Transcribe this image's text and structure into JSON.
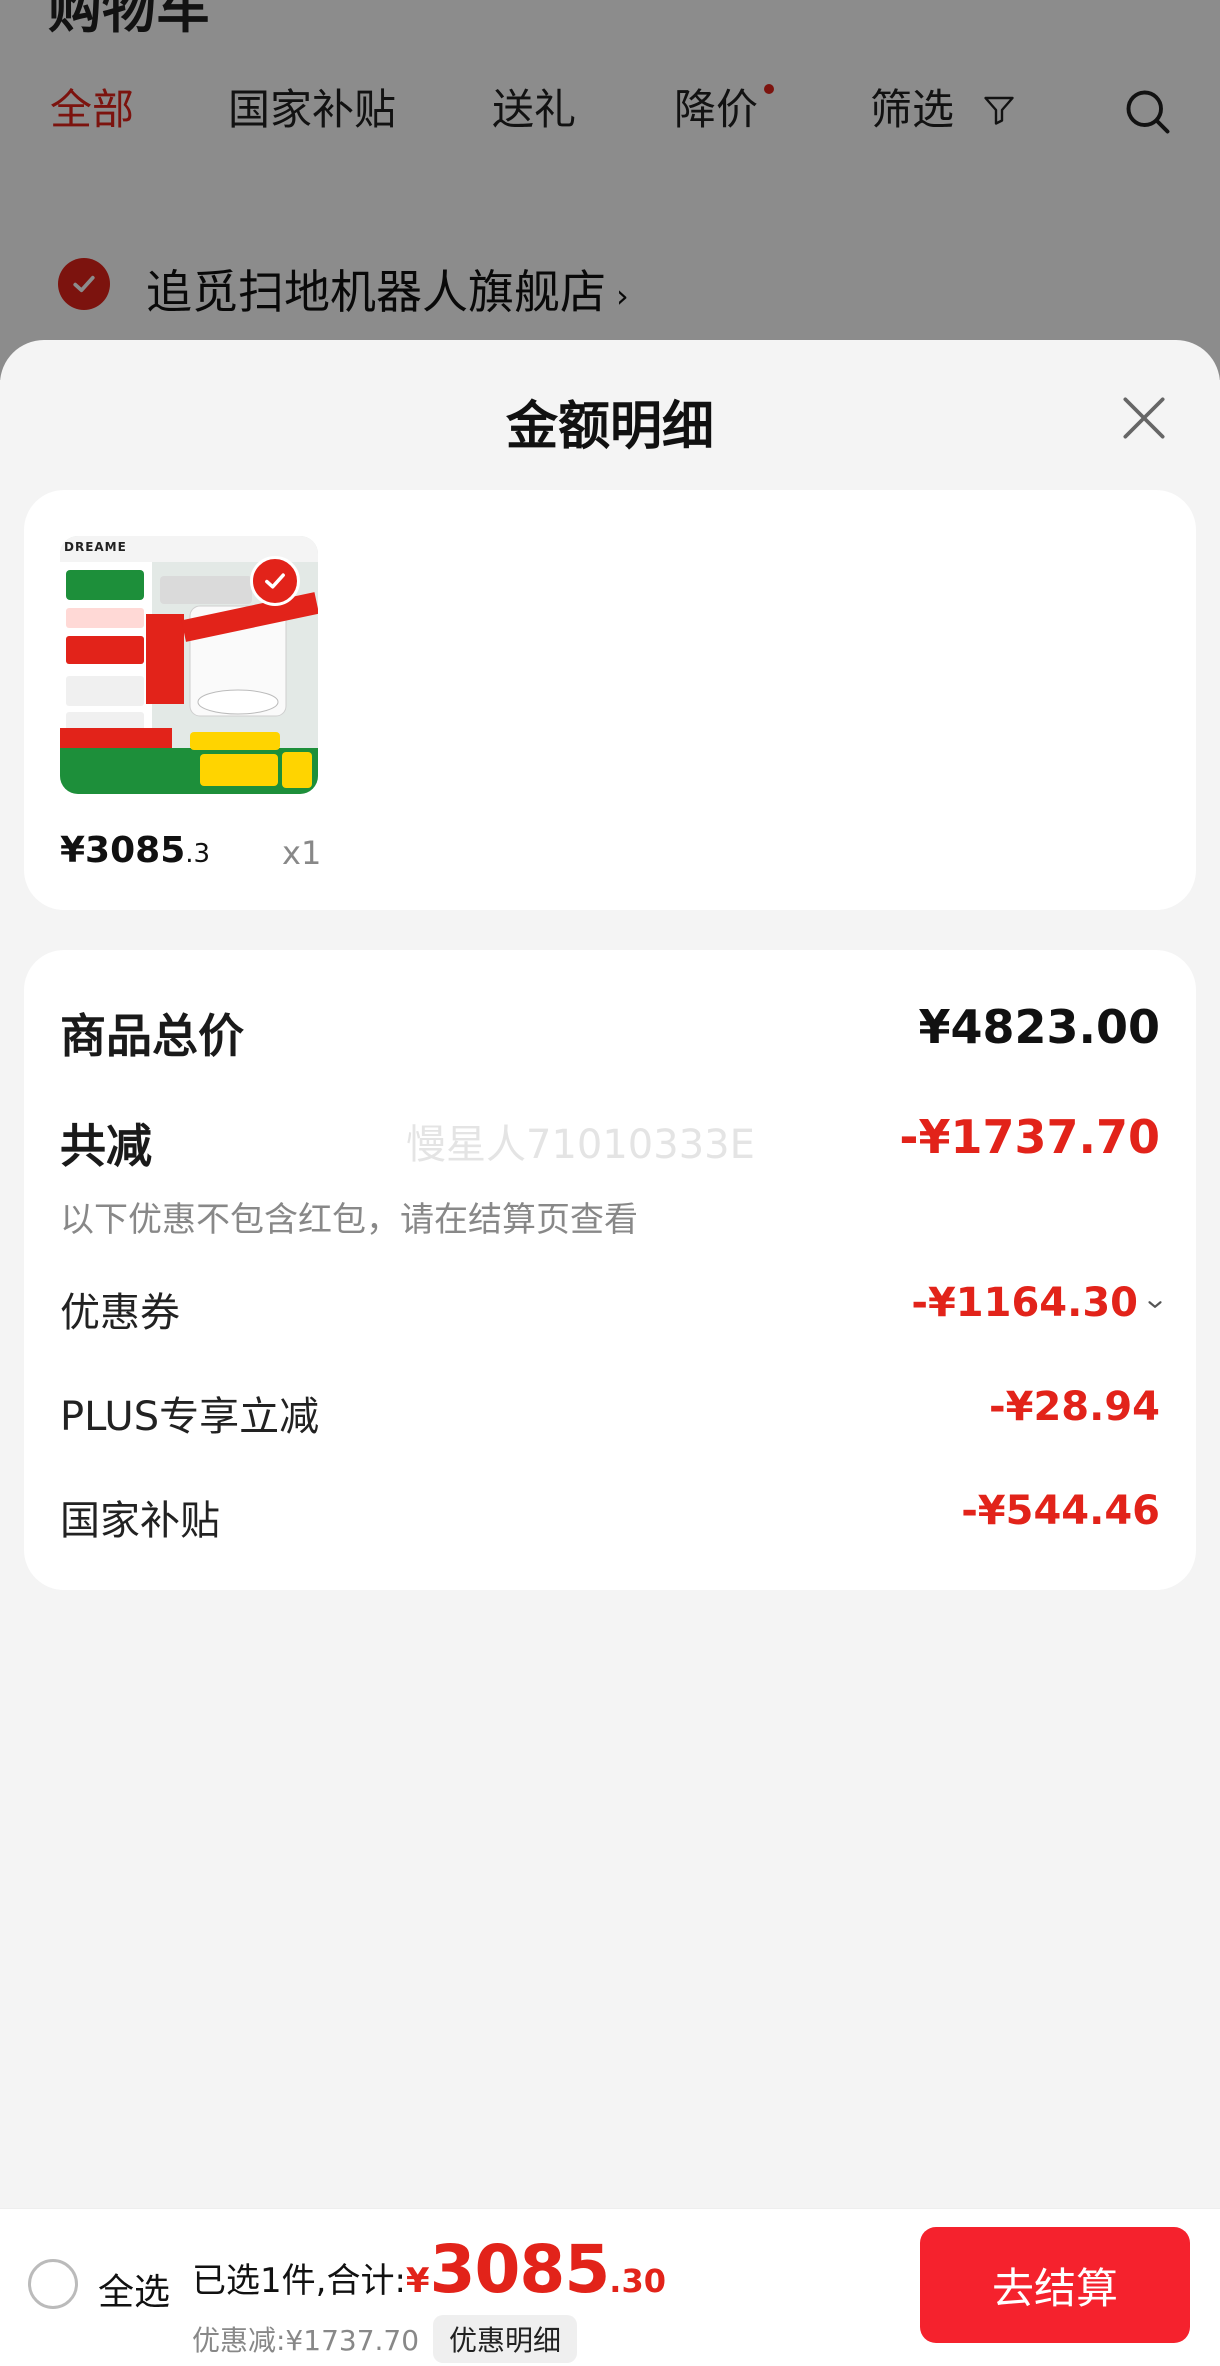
{
  "background": {
    "title": "购物车",
    "tabs": [
      {
        "label": "全部",
        "active": true
      },
      {
        "label": "国家补贴",
        "active": false
      },
      {
        "label": "送礼",
        "active": false
      },
      {
        "label": "降价",
        "active": false,
        "has_dot": true
      },
      {
        "label": "筛选",
        "active": false
      }
    ],
    "search_icon": "search-icon",
    "store_name": "追觅扫地机器人旗舰店"
  },
  "sheet": {
    "title": "金额明细",
    "close_icon": "close-icon"
  },
  "product": {
    "brand": "DREAME",
    "price_main": "¥3085",
    "price_decimal": ".3",
    "quantity": "x1"
  },
  "breakdown": {
    "total_label": "商品总价",
    "total_value": "¥4823.00",
    "reduce_label": "共减",
    "reduce_value": "-¥1737.70",
    "watermark": "慢星人71010333E",
    "note": "以下优惠不包含红包，请在结算页查看",
    "items": [
      {
        "label": "优惠券",
        "value": "-¥1164.30"
      },
      {
        "label": "PLUS专享立减",
        "value": "-¥28.94"
      },
      {
        "label": "国家补贴",
        "value": "-¥544.46"
      }
    ]
  },
  "bottom_bar": {
    "select_all": "全选",
    "summary_label": "已选1件,合计:",
    "yen": "¥",
    "total_int": "3085",
    "total_dec": ".30",
    "discount_text": "优惠减:¥1737.70",
    "detail_chip": "优惠明细",
    "checkout": "去结算"
  },
  "colors": {
    "accent": "#e2231a",
    "checkout_button": "#f5222d",
    "sheet_bg": "#f4f4f4"
  }
}
